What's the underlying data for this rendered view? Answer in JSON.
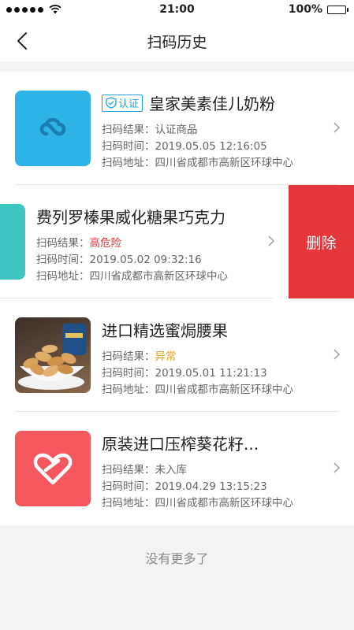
{
  "status_bar": {
    "time": "21:00",
    "battery": "100%"
  },
  "nav": {
    "title": "扫码历史",
    "back_icon": "chevron-left-icon"
  },
  "labels": {
    "result": "扫码结果：",
    "time": "扫码时间：",
    "address": "扫码地址："
  },
  "items": [
    {
      "badge": "认证",
      "name": "皇家美素佳儿奶粉",
      "result": "认证商品",
      "time": "2019.05.05 12:16:05",
      "address": "四川省成都市高新区环球中心"
    },
    {
      "name": "费列罗榛果威化糖果巧克力",
      "result": "高危险",
      "time": "2019.05.02  09:32:16",
      "address": "四川省成都市高新区环球中心",
      "delete_label": "删除"
    },
    {
      "name": "进口精选蜜焗腰果",
      "result": "异常",
      "time": "2019.05.01 11:21:13",
      "address": "四川省成都市高新区环球中心"
    },
    {
      "name": "原装进口压榨葵花籽...",
      "result": "未入库",
      "time": "2019.04.29 13:15:23",
      "address": "四川省成都市高新区环球中心"
    }
  ],
  "colors": {
    "accent": "#1fa1d6",
    "danger": "#e5373b",
    "warning": "#e0a020",
    "thumb_blue": "#2eb3e8",
    "thumb_teal": "#3dc6c2",
    "thumb_red": "#f4585e"
  },
  "footer": {
    "text": "没有更多了"
  }
}
